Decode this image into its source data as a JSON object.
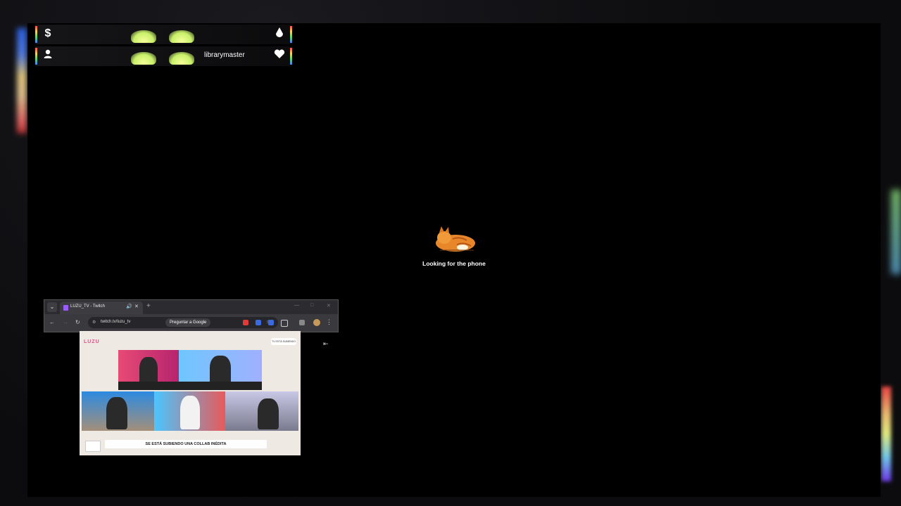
{
  "overlay": {
    "stats": {
      "row1": {
        "left_icon": "dollar-icon",
        "left_glyph": "$",
        "right_icon": "drop-icon"
      },
      "row2": {
        "left_icon": "user-icon",
        "username": "librarymaster",
        "right_icon": "heart-icon"
      }
    },
    "loading": {
      "message": "Looking for the phone",
      "icon": "cat-icon"
    }
  },
  "browser": {
    "tab": {
      "title": "LUZU_TV - Twitch",
      "audio_icon": "speaker-icon",
      "close_icon": "close-icon"
    },
    "new_tab_glyph": "+",
    "url": "twitch.tv/luzu_tv",
    "ask_google": "Preguntar a Google",
    "colors": {
      "tab_favicon": "#9b5cff",
      "ext1": "#e03a3a",
      "ext2": "#3a6ae0",
      "ext3": "#3a6ae0"
    }
  },
  "video": {
    "logo": "LUZU",
    "badge": "TV ESTÁ SUBIENDO",
    "caption": "SE ESTÁ SUBIENDO UNA COLLAB INÉDITA"
  }
}
